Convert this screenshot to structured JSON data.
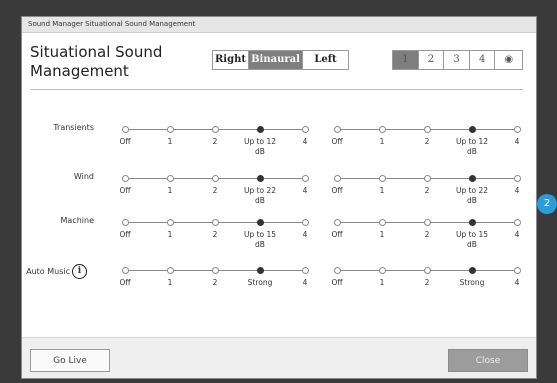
{
  "window_title": "Sound Manager Situational Sound Management",
  "heading": "Situational Sound Management",
  "side_selector": [
    "Right",
    "Binaural",
    "Left"
  ],
  "side_active": "Binaural",
  "program_selector": [
    "1",
    "2",
    "3",
    "4",
    "◉"
  ],
  "program_active": "1",
  "rows": [
    {
      "label": "Transients",
      "ticks": [
        "Off",
        "1",
        "2",
        "Up to 12 dB",
        "4"
      ],
      "left_selected": 3,
      "right_selected": 3
    },
    {
      "label": "Wind",
      "ticks": [
        "Off",
        "1",
        "2",
        "Up to 22 dB",
        "4"
      ],
      "left_selected": 3,
      "right_selected": 3
    },
    {
      "label": "Machine",
      "ticks": [
        "Off",
        "1",
        "2",
        "Up to 15 dB",
        "4"
      ],
      "left_selected": 3,
      "right_selected": 3
    },
    {
      "label": "Auto Music",
      "ticks": [
        "Off",
        "1",
        "2",
        "Strong",
        "4"
      ],
      "left_selected": 3,
      "right_selected": 3
    }
  ],
  "info_icon_glyph": "i",
  "buttons": {
    "go_live": "Go Live",
    "close": "Close"
  },
  "badge": "2"
}
